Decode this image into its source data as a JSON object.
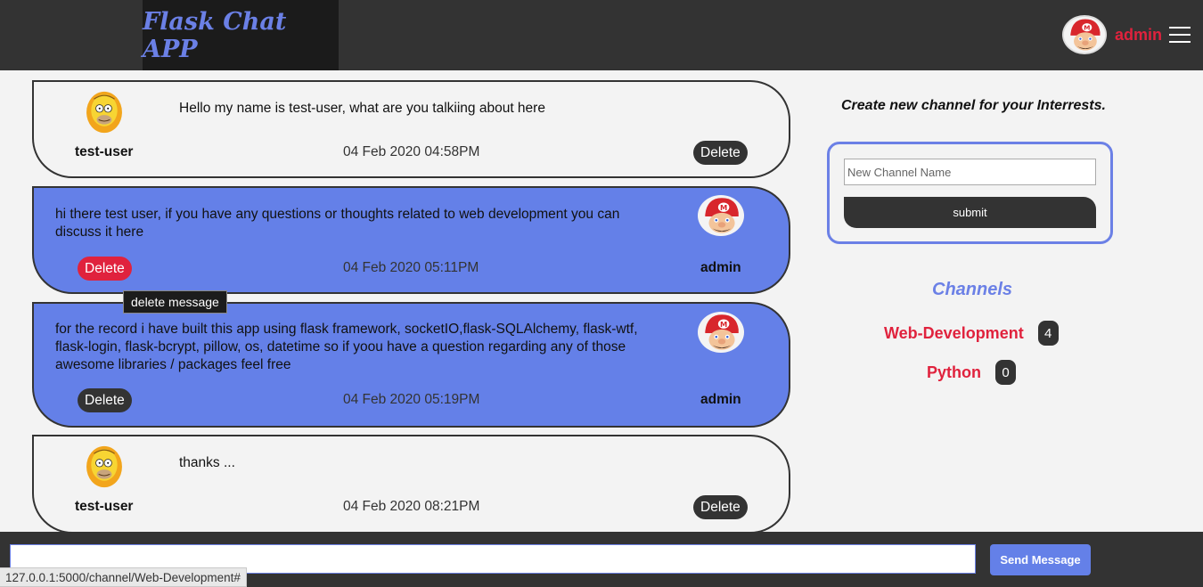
{
  "header": {
    "brand": "Flask Chat APP",
    "username": "admin"
  },
  "messages": [
    {
      "text": "Hello my name is test-user, what are you talkiing about here",
      "time": "04 Feb 2020 04:58PM",
      "user": "test-user",
      "delete_label": "Delete"
    },
    {
      "text": "hi there test user, if you have any questions or thoughts related to web development you can discuss it here",
      "time": "04 Feb 2020 05:11PM",
      "user": "admin",
      "delete_label": "Delete"
    },
    {
      "text": "for the record i have built this app using flask framework, socketIO,flask-SQLAlchemy, flask-wtf, flask-login, flask-bcrypt, pillow, os, datetime so if yoou have a question regarding any of those awesome libraries / packages feel free",
      "time": "04 Feb 2020 05:19PM",
      "user": "admin",
      "delete_label": "Delete"
    },
    {
      "text": "thanks ...",
      "time": "04 Feb 2020 08:21PM",
      "user": "test-user",
      "delete_label": "Delete"
    }
  ],
  "tooltip": "delete message",
  "sidebar": {
    "create_title": "Create new channel for your Interrests.",
    "channel_placeholder": "New Channel Name",
    "submit_label": "submit",
    "channels_title": "Channels",
    "channels": [
      {
        "name": "Web-Development",
        "count": "4"
      },
      {
        "name": "Python",
        "count": "0"
      }
    ]
  },
  "footer": {
    "message_value": "",
    "send_label": "Send Message"
  },
  "status_url": "127.0.0.1:5000/channel/Web-Development#",
  "colors": {
    "accent": "#6480e8",
    "danger": "#e0223d",
    "dark": "#333333"
  },
  "icons": {
    "admin_avatar": "mario-avatar-icon",
    "user_avatar": "homer-avatar-icon",
    "menu": "hamburger-menu-icon"
  }
}
